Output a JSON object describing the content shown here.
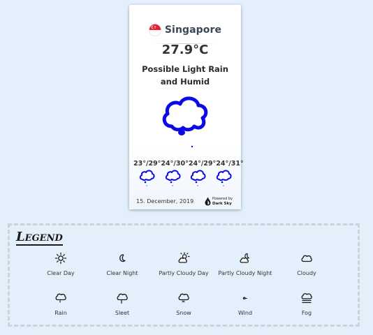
{
  "card": {
    "city": "Singapore",
    "temperature": "27.9°C",
    "summary_line1": "Possible Light Rain",
    "summary_line2": "and Humid",
    "current_icon": "rain-icon",
    "accent_color": "#0a0ae6",
    "forecast": [
      {
        "temps": "23°/29°",
        "icon": "rain-icon"
      },
      {
        "temps": "24°/30°",
        "icon": "rain-icon"
      },
      {
        "temps": "24°/29°",
        "icon": "rain-icon"
      },
      {
        "temps": "24°/31°",
        "icon": "rain-icon"
      }
    ],
    "date": "15. December, 2019",
    "powered_by_line1": "Powered by",
    "powered_by_line2": "Dark Sky"
  },
  "legend": {
    "title": "Legend",
    "items": [
      {
        "label": "Clear Day",
        "icon": "clear-day-icon"
      },
      {
        "label": "Clear Night",
        "icon": "clear-night-icon"
      },
      {
        "label": "Partly Cloudy Day",
        "icon": "partly-cloudy-day-icon"
      },
      {
        "label": "Partly Cloudy Night",
        "icon": "partly-cloudy-night-icon"
      },
      {
        "label": "Cloudy",
        "icon": "cloudy-icon"
      },
      {
        "label": "Rain",
        "icon": "rain-icon"
      },
      {
        "label": "Sleet",
        "icon": "sleet-icon"
      },
      {
        "label": "Snow",
        "icon": "snow-icon"
      },
      {
        "label": "Wind",
        "icon": "wind-icon"
      },
      {
        "label": "Fog",
        "icon": "fog-icon"
      }
    ]
  }
}
